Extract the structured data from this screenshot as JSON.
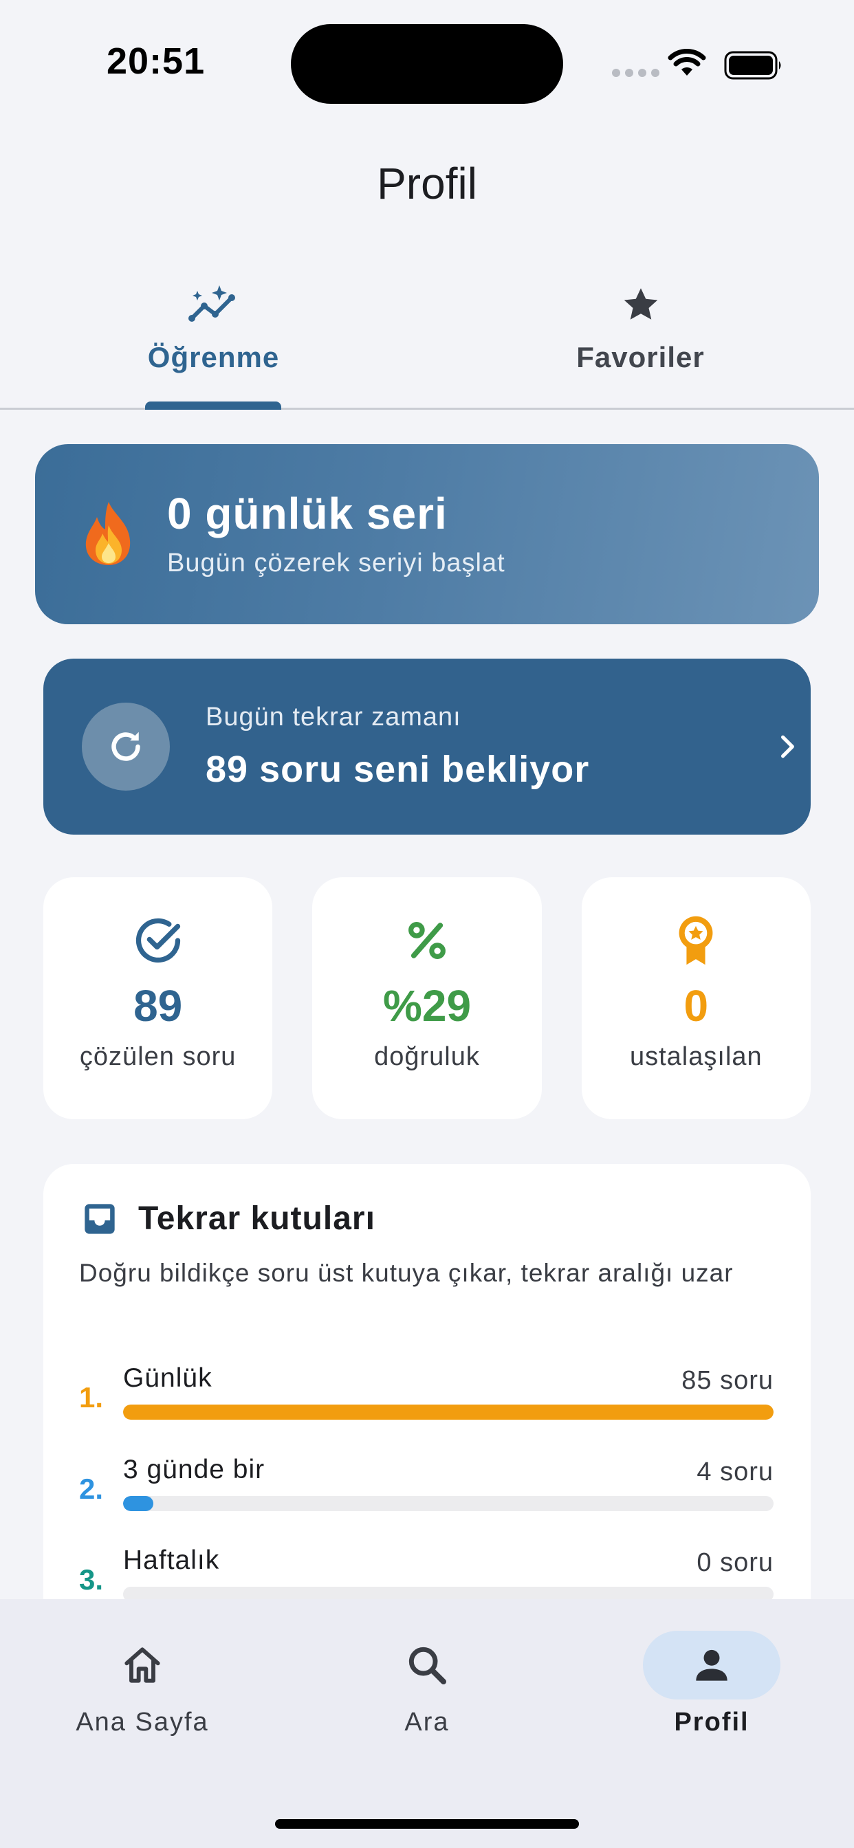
{
  "status_bar": {
    "time": "20:51"
  },
  "header": {
    "title": "Profil"
  },
  "tabs": [
    {
      "label": "Öğrenme",
      "icon": "trending-sparkle-icon",
      "active": true
    },
    {
      "label": "Favoriler",
      "icon": "star-icon",
      "active": false
    }
  ],
  "streak": {
    "emoji": "fire-icon",
    "title": "0 günlük seri",
    "subtitle": "Bugün çözerek seriyi başlat"
  },
  "review": {
    "subtitle": "Bugün tekrar zamanı",
    "title": "89 soru seni bekliyor",
    "icon": "refresh-icon"
  },
  "stats": [
    {
      "icon": "check-circle-icon",
      "value": "89",
      "label": "çözülen soru",
      "color": "#2f6490"
    },
    {
      "icon": "percent-icon",
      "value": "%29",
      "label": "doğruluk",
      "color": "#3f9b48"
    },
    {
      "icon": "award-icon",
      "value": "0",
      "label": "ustalaşılan",
      "color": "#f29d0f"
    }
  ],
  "boxes": {
    "title": "Tekrar kutuları",
    "description": "Doğru bildikçe soru üst kutuya çıkar, tekrar aralığı uzar",
    "items": [
      {
        "number": "1.",
        "name": "Günlük",
        "count": "85 soru",
        "fraction": 1.0,
        "color": "#f29d0f"
      },
      {
        "number": "2.",
        "name": "3 günde bir",
        "count": "4 soru",
        "fraction": 0.047,
        "color": "#2e93e0"
      },
      {
        "number": "3.",
        "name": "Haftalık",
        "count": "0 soru",
        "fraction": 0.0,
        "color": "#159688"
      }
    ]
  },
  "bottom_nav": [
    {
      "label": "Ana Sayfa",
      "icon": "home-icon",
      "active": false
    },
    {
      "label": "Ara",
      "icon": "search-icon",
      "active": false
    },
    {
      "label": "Profil",
      "icon": "person-icon",
      "active": true
    }
  ]
}
